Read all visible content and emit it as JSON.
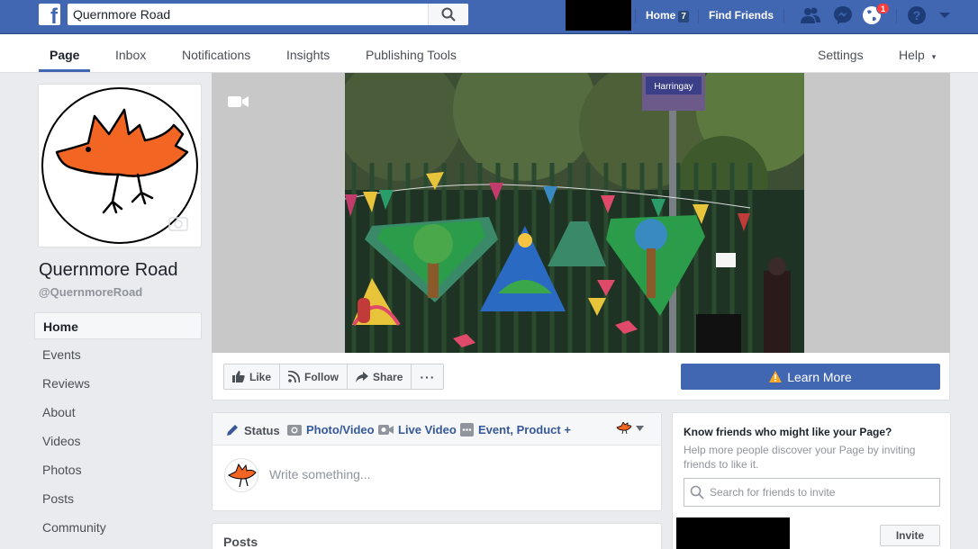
{
  "topbar": {
    "search_value": "Quernmore Road",
    "home_label": "Home",
    "home_count": "7",
    "find_friends_label": "Find Friends",
    "notification_count": "1"
  },
  "tabs": {
    "page": "Page",
    "inbox": "Inbox",
    "notifications": "Notifications",
    "insights": "Insights",
    "publishing_tools": "Publishing Tools",
    "settings": "Settings",
    "help": "Help",
    "help_caret": "▾"
  },
  "page": {
    "name": "Quernmore Road",
    "handle": "@QuernmoreRoad"
  },
  "sidebar": {
    "items": [
      {
        "label": "Home"
      },
      {
        "label": "Events"
      },
      {
        "label": "Reviews"
      },
      {
        "label": "About"
      },
      {
        "label": "Videos"
      },
      {
        "label": "Photos"
      },
      {
        "label": "Posts"
      },
      {
        "label": "Community"
      }
    ]
  },
  "cover": {
    "sign_text": "Harringay"
  },
  "actions": {
    "like": "Like",
    "follow": "Follow",
    "share": "Share",
    "more": "···",
    "learn_more": "Learn More"
  },
  "composer": {
    "status": "Status",
    "photo_video": "Photo/Video",
    "live_video": "Live Video",
    "event_product": "Event, Product +",
    "placeholder": "Write something..."
  },
  "posts": {
    "title": "Posts"
  },
  "invite": {
    "title": "Know friends who might like your Page?",
    "description": "Help more people discover your Page by inviting friends to like it.",
    "search_placeholder": "Search for friends to invite",
    "invite_button": "Invite"
  },
  "colors": {
    "brand": "#4267b2",
    "link": "#365899",
    "bird": "#f26522",
    "notification": "#fa3e3e"
  }
}
